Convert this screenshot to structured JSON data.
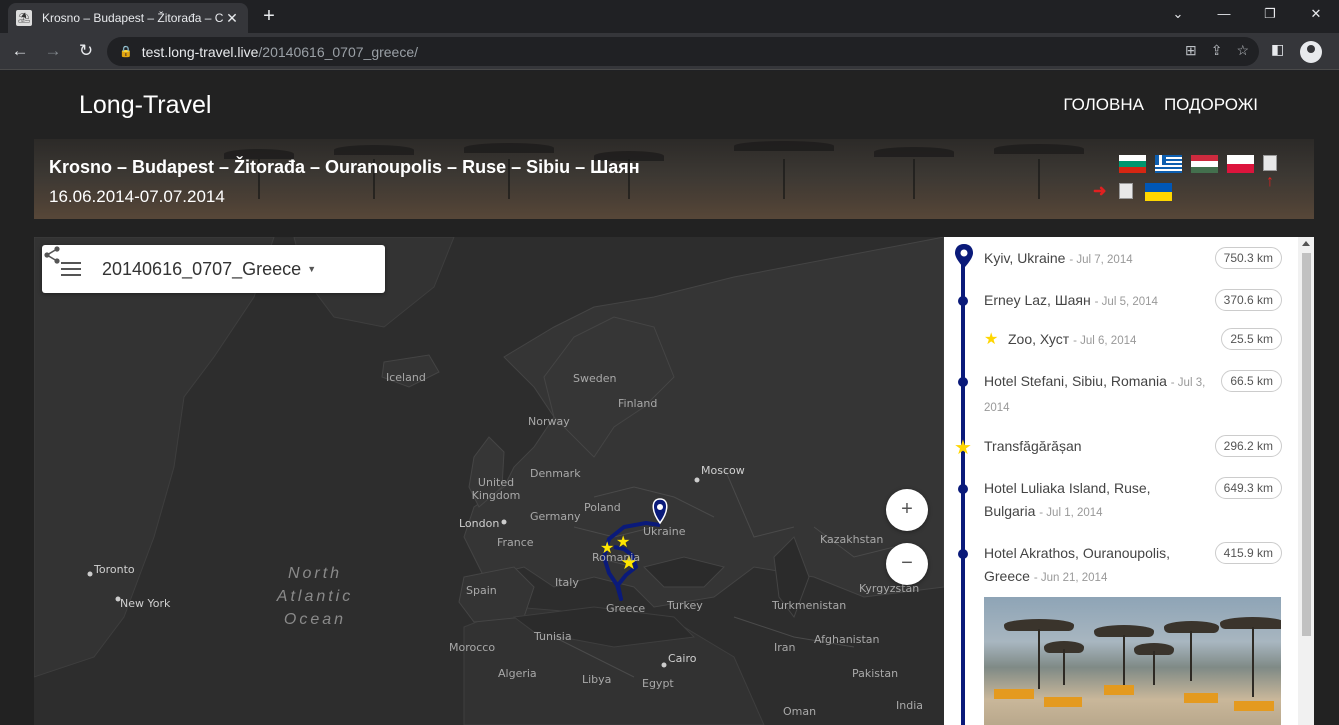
{
  "browser": {
    "tab_title": "Krosno – Budapest – Žitorađa – C",
    "tab_close": "✕",
    "new_tab": "+",
    "url_host": "test.long-travel.live",
    "url_path": "/20140616_0707_greece/"
  },
  "site": {
    "brand": "Long-Travel",
    "nav": [
      "ГОЛОВНА",
      "ПОДОРОЖІ"
    ]
  },
  "hero": {
    "title": "Krosno – Budapest – Žitorađa – Ouranoupolis – Ruse – Sibiu – Шаян",
    "dates": "16.06.2014-07.07.2014",
    "flags": [
      "bulgaria",
      "greece",
      "hungary",
      "poland",
      "broken-image",
      "broken-image",
      "ukraine"
    ]
  },
  "map": {
    "control_title": "20140616_0707_Greece",
    "zoom_in": "+",
    "zoom_out": "−",
    "ocean_lines": [
      "North",
      "Atlantic",
      "Ocean"
    ],
    "labels": {
      "iceland": "Iceland",
      "sweden": "Sweden",
      "finland": "Finland",
      "norway": "Norway",
      "denmark": "Denmark",
      "uk": "United Kingdom",
      "london": "London",
      "poland": "Poland",
      "germany": "Germany",
      "france": "France",
      "moscow": "Moscow",
      "ukraine": "Ukraine",
      "romania": "Romania",
      "italy": "Italy",
      "spain": "Spain",
      "greece": "Greece",
      "turkey": "Turkey",
      "kazakhstan": "Kazakhstan",
      "turkmenistan": "Turkmenistan",
      "kyrgyzstan": "Kyrgyzstan",
      "afghanistan": "Afghanistan",
      "iran": "Iran",
      "pakistan": "Pakistan",
      "tunisia": "Tunisia",
      "morocco": "Morocco",
      "algeria": "Algeria",
      "libya": "Libya",
      "egypt": "Egypt",
      "cairo": "Cairo",
      "oman": "Oman",
      "india": "India",
      "toronto": "Toronto",
      "new_york": "New York"
    }
  },
  "itinerary": [
    {
      "name": "Kyiv, Ukraine",
      "date": "Jul 7, 2014",
      "distance": "750.3 km",
      "marker": "pin"
    },
    {
      "name": "Erney Laz, Шаян",
      "date": "Jul 5, 2014",
      "distance": "370.6 km",
      "marker": "dot"
    },
    {
      "name": "Zoo, Хуст",
      "date": "Jul 6, 2014",
      "distance": "25.5 km",
      "marker": "star-indented"
    },
    {
      "name": "Hotel Stefani, Sibiu, Romania",
      "date": "Jul 3, 2014",
      "distance": "66.5 km",
      "marker": "dot"
    },
    {
      "name": "Transfăgărășan",
      "date": "",
      "distance": "296.2 km",
      "marker": "star"
    },
    {
      "name": "Hotel Luliaka Island, Ruse, Bulgaria",
      "date": "Jul 1, 2014",
      "distance": "649.3 km",
      "marker": "dot"
    },
    {
      "name": "Hotel Akrathos, Ouranoupolis, Greece",
      "date": "Jun 21, 2014",
      "distance": "415.9 km",
      "marker": "dot"
    }
  ],
  "colors": {
    "route": "#0a1a7a",
    "star": "#ffd600",
    "page_bg": "#222222"
  }
}
